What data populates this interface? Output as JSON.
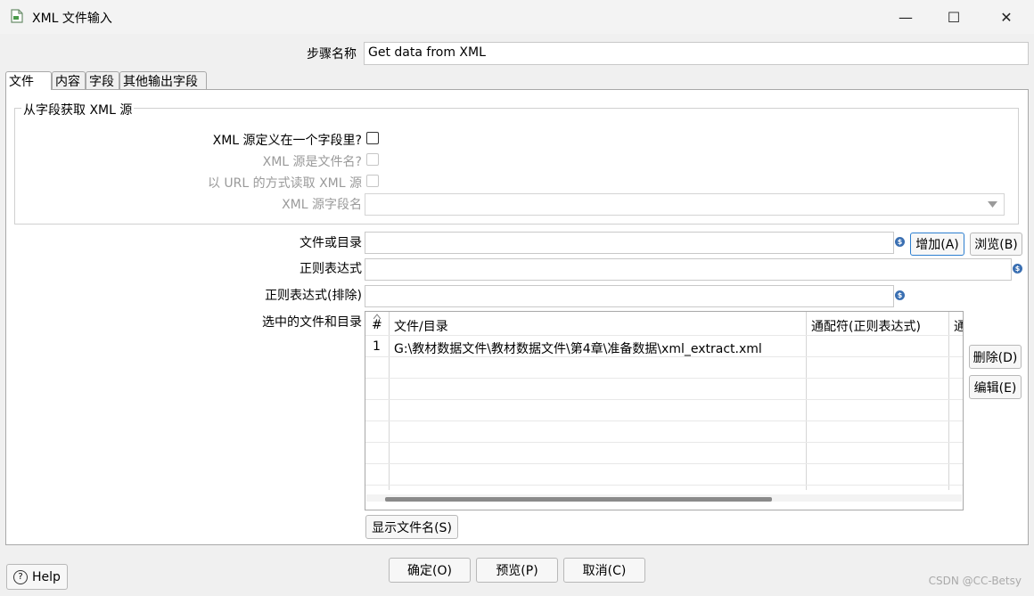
{
  "window": {
    "title": "XML 文件输入",
    "minimize_glyph": "—",
    "maximize_glyph": "☐",
    "close_glyph": "✕"
  },
  "step_name": {
    "label": "步骤名称",
    "value": "Get data from XML"
  },
  "tabs": [
    {
      "label": "文件",
      "active": true
    },
    {
      "label": "内容",
      "active": false
    },
    {
      "label": "字段",
      "active": false
    },
    {
      "label": "其他输出字段",
      "active": false
    }
  ],
  "xml_source_group": {
    "title": "从字段获取 XML 源",
    "defined_in_field": {
      "label": "XML 源定义在一个字段里?",
      "checked": false
    },
    "is_filename": {
      "label": "XML 源是文件名?",
      "checked": false
    },
    "read_as_url": {
      "label": "以 URL 的方式读取 XML 源",
      "checked": false
    },
    "field_name": {
      "label": "XML 源字段名",
      "value": ""
    }
  },
  "file_or_dir": {
    "label": "文件或目录",
    "value": "",
    "add_button": "增加(A)",
    "browse_button": "浏览(B)"
  },
  "regex": {
    "label": "正则表达式",
    "value": ""
  },
  "regex_exclude": {
    "label": "正则表达式(排除)",
    "value": ""
  },
  "selected_files": {
    "label": "选中的文件和目录",
    "columns": [
      "#",
      "文件/目录",
      "通配符(正则表达式)",
      "通"
    ],
    "rows": [
      {
        "num": "1",
        "path": "G:\\教材数据文件\\教材数据文件\\第4章\\准备数据\\xml_extract.xml",
        "wildcard": ""
      }
    ],
    "delete_button": "删除(D)",
    "edit_button": "编辑(E)",
    "show_filenames_button": "显示文件名(S)"
  },
  "footer": {
    "help_button": "Help",
    "ok_button": "确定(O)",
    "preview_button": "预览(P)",
    "cancel_button": "取消(C)"
  },
  "watermark": "CSDN @CC-Betsy"
}
